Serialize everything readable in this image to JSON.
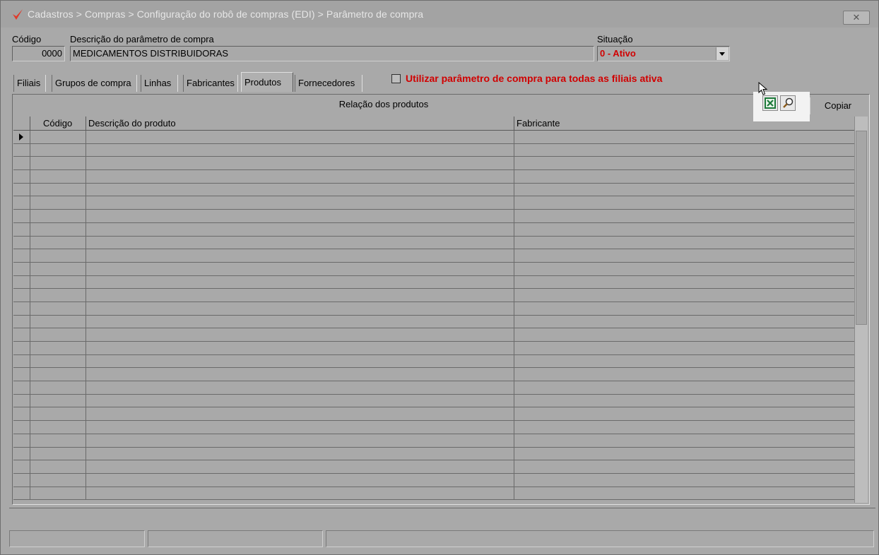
{
  "window": {
    "breadcrumb": "Cadastros > Compras > Configuração do robô de compras (EDI) > Parâmetro de compra",
    "close_label": "✕"
  },
  "form": {
    "codigo_label": "Código",
    "codigo_value": "0000",
    "descricao_label": "Descrição do parâmetro de compra",
    "descricao_value": "MEDICAMENTOS DISTRIBUIDORAS",
    "situacao_label": "Situação",
    "situacao_value": "0 - Ativo",
    "situacao_color": "#d10000"
  },
  "tabs": [
    {
      "label": "Filiais"
    },
    {
      "label": "Grupos de compra"
    },
    {
      "label": "Linhas"
    },
    {
      "label": "Fabricantes"
    },
    {
      "label": "Produtos",
      "active": true
    },
    {
      "label": "Fornecedores"
    }
  ],
  "options": {
    "todas_filiais_label": "Utilizar parâmetro de compra para todas as filiais ativa",
    "todas_filiais_checked": false
  },
  "panel": {
    "title": "Relação dos produtos",
    "excel_icon": "excel-icon",
    "search_icon": "search-icon",
    "copy_label": "Copiar"
  },
  "grid": {
    "columns": [
      "Código",
      "Descrição do produto",
      "Fabricante"
    ],
    "row_count": 28
  }
}
